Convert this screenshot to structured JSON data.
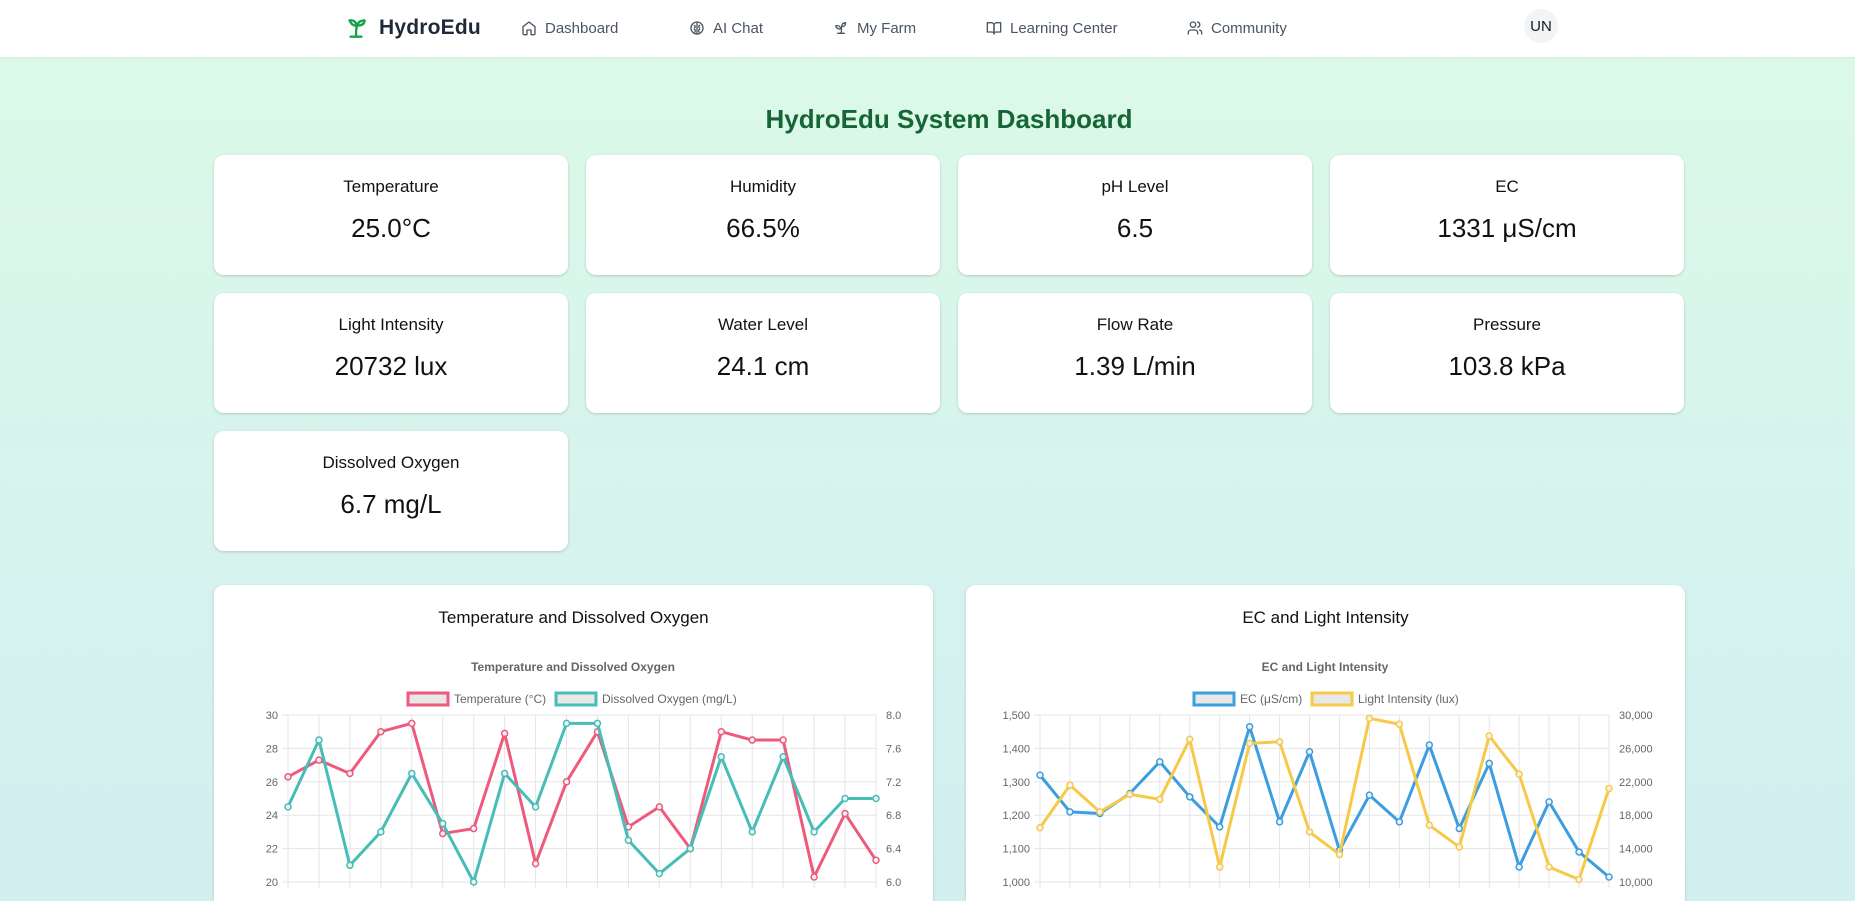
{
  "app": {
    "brand": "HydroEdu"
  },
  "nav": {
    "items": [
      {
        "key": "dashboard",
        "label": "Dashboard",
        "icon": "home-icon"
      },
      {
        "key": "ai-chat",
        "label": "AI Chat",
        "icon": "brain-icon"
      },
      {
        "key": "my-farm",
        "label": "My Farm",
        "icon": "sprout-icon"
      },
      {
        "key": "learning-center",
        "label": "Learning Center",
        "icon": "book-icon"
      },
      {
        "key": "community",
        "label": "Community",
        "icon": "users-icon"
      }
    ]
  },
  "user": {
    "initials": "UN"
  },
  "page": {
    "title": "HydroEdu System Dashboard"
  },
  "metrics": [
    {
      "label": "Temperature",
      "value": "25.0°C"
    },
    {
      "label": "Humidity",
      "value": "66.5%"
    },
    {
      "label": "pH Level",
      "value": "6.5"
    },
    {
      "label": "EC",
      "value": "1331 μS/cm"
    },
    {
      "label": "Light Intensity",
      "value": "20732 lux"
    },
    {
      "label": "Water Level",
      "value": "24.1 cm"
    },
    {
      "label": "Flow Rate",
      "value": "1.39 L/min"
    },
    {
      "label": "Pressure",
      "value": "103.8 kPa"
    },
    {
      "label": "Dissolved Oxygen",
      "value": "6.7 mg/L"
    }
  ],
  "colors": {
    "brand": "#16a34a",
    "title": "#166534",
    "temperature": "#ee5a7c",
    "oxygen": "#46bdb6",
    "ec": "#3a9ee0",
    "light": "#f7c948"
  },
  "chart_data": [
    {
      "type": "line",
      "heading": "Temperature and Dissolved Oxygen",
      "title": "Temperature and Dissolved Oxygen",
      "series": [
        {
          "name": "Temperature (°C)",
          "axis": "left",
          "values": [
            26.3,
            27.3,
            26.5,
            29.0,
            29.5,
            22.9,
            23.2,
            28.9,
            21.1,
            26.0,
            29.0,
            23.3,
            24.5,
            22.0,
            29.0,
            28.5,
            28.5,
            20.3,
            24.1,
            21.3
          ]
        },
        {
          "name": "Dissolved Oxygen (mg/L)",
          "axis": "right",
          "values": [
            6.9,
            7.7,
            6.2,
            6.6,
            7.3,
            6.7,
            6.0,
            7.3,
            6.9,
            7.9,
            7.9,
            6.5,
            6.1,
            6.4,
            7.5,
            6.6,
            7.5,
            6.6,
            7.0,
            7.0
          ]
        }
      ],
      "y_left": {
        "min": 20,
        "max": 30,
        "ticks": [
          20,
          22,
          24,
          26,
          28,
          30
        ]
      },
      "y_right": {
        "min": 6.0,
        "max": 8.0,
        "ticks": [
          6.0,
          6.4,
          6.8,
          7.2,
          7.6,
          8.0
        ]
      },
      "legend": "top",
      "grid": true
    },
    {
      "type": "line",
      "heading": "EC and Light Intensity",
      "title": "EC and Light Intensity",
      "series": [
        {
          "name": "EC (μS/cm)",
          "axis": "left",
          "values": [
            1320,
            1210,
            1205,
            1265,
            1360,
            1255,
            1165,
            1465,
            1180,
            1390,
            1095,
            1260,
            1180,
            1410,
            1160,
            1355,
            1045,
            1240,
            1090,
            1015
          ]
        },
        {
          "name": "Light Intensity (lux)",
          "axis": "right",
          "values": [
            16500,
            21600,
            18400,
            20500,
            19900,
            27100,
            11800,
            26600,
            26800,
            16000,
            13300,
            29600,
            28900,
            16800,
            14200,
            27500,
            22900,
            11800,
            10300,
            21200
          ]
        }
      ],
      "y_left": {
        "min": 1000,
        "max": 1500,
        "ticks": [
          "1,000",
          "1,100",
          "1,200",
          "1,300",
          "1,400",
          "1,500"
        ]
      },
      "y_right": {
        "min": 10000,
        "max": 30000,
        "ticks": [
          "10,000",
          "14,000",
          "18,000",
          "22,000",
          "26,000",
          "30,000"
        ]
      },
      "legend": "top",
      "grid": true
    }
  ]
}
